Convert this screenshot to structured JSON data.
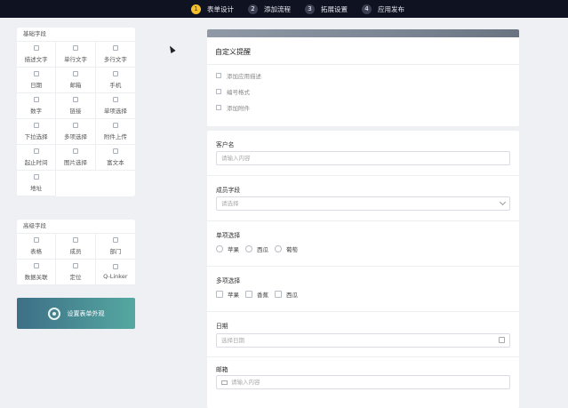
{
  "steps": [
    {
      "num": "1",
      "label": "表单设计"
    },
    {
      "num": "2",
      "label": "添加流程"
    },
    {
      "num": "3",
      "label": "拓展设置"
    },
    {
      "num": "4",
      "label": "应用发布"
    }
  ],
  "basic_fields": {
    "title": "基础字段",
    "items": [
      "描述文字",
      "单行文字",
      "多行文字",
      "日期",
      "邮箱",
      "手机",
      "数字",
      "链接",
      "单项选择",
      "下拉选择",
      "多项选择",
      "附件上传",
      "起止时间",
      "图片选择",
      "富文本",
      "地址"
    ]
  },
  "advanced_fields": {
    "title": "高级字段",
    "items": [
      "表格",
      "成员",
      "部门",
      "数据关联",
      "定位",
      "Q-Linker"
    ]
  },
  "appearance_button": "设置表单外观",
  "form": {
    "title": "自定义提醒",
    "header_links": [
      "添加应用描述",
      "编号格式",
      "添加附件"
    ],
    "fields": {
      "customer": {
        "label": "客户名",
        "placeholder": "请输入内容"
      },
      "member": {
        "label": "成员字段",
        "placeholder": "请选择"
      },
      "single": {
        "label": "单项选择",
        "options": [
          "苹果",
          "西瓜",
          "葡萄"
        ]
      },
      "multi": {
        "label": "多项选择",
        "options": [
          "苹果",
          "香蕉",
          "西瓜"
        ]
      },
      "date": {
        "label": "日期",
        "placeholder": "选择日期"
      },
      "email": {
        "label": "邮箱",
        "placeholder": "请输入内容"
      }
    }
  }
}
